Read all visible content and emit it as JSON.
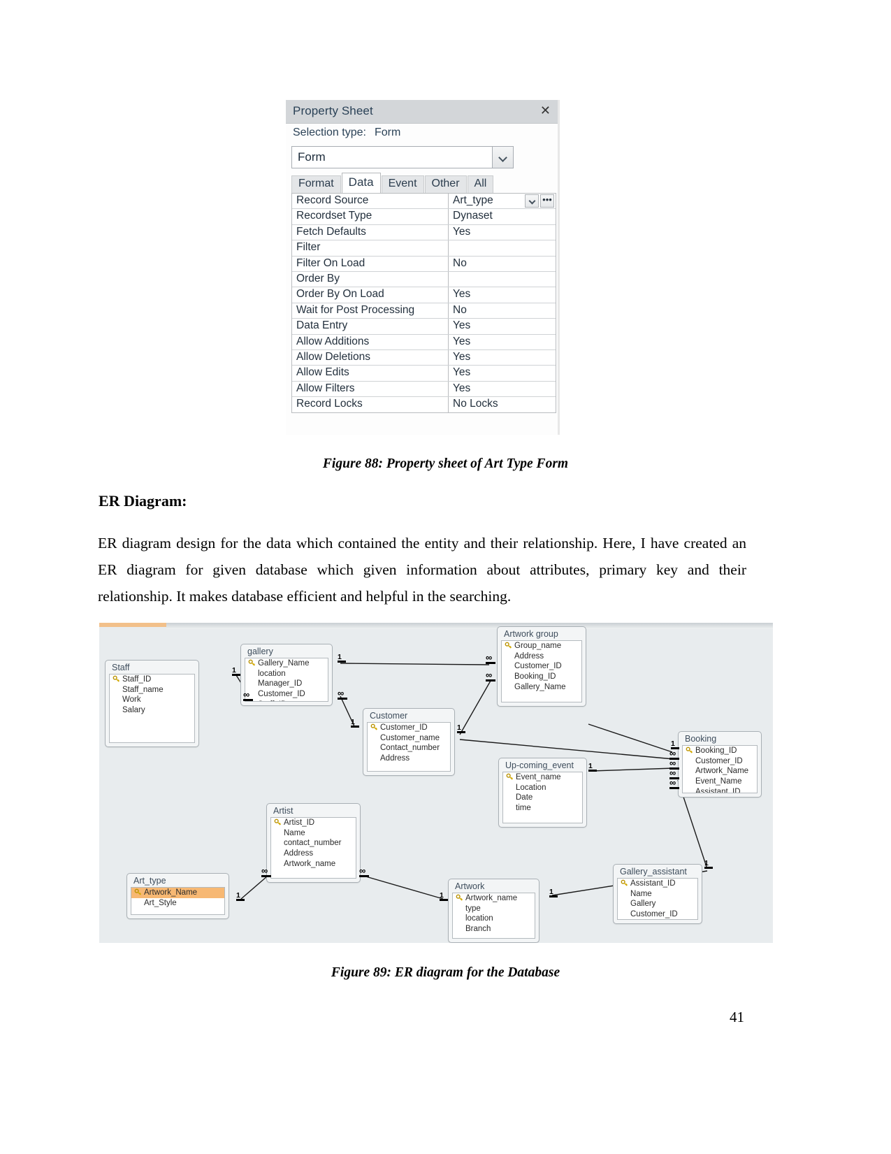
{
  "figure88": {
    "title": "Property Sheet",
    "close_icon": "close-icon",
    "selection_label": "Selection type:",
    "selection_value": "Form",
    "combo_value": "Form",
    "tabs": [
      "Format",
      "Data",
      "Event",
      "Other",
      "All"
    ],
    "active_tab": "Data",
    "properties": [
      {
        "key": "Record Source",
        "value": "Art_type"
      },
      {
        "key": "Recordset Type",
        "value": "Dynaset"
      },
      {
        "key": "Fetch Defaults",
        "value": "Yes"
      },
      {
        "key": "Filter",
        "value": ""
      },
      {
        "key": "Filter On Load",
        "value": "No"
      },
      {
        "key": "Order By",
        "value": ""
      },
      {
        "key": "Order By On Load",
        "value": "Yes"
      },
      {
        "key": "Wait for Post Processing",
        "value": "No"
      },
      {
        "key": "Data Entry",
        "value": "Yes"
      },
      {
        "key": "Allow Additions",
        "value": "Yes"
      },
      {
        "key": "Allow Deletions",
        "value": "Yes"
      },
      {
        "key": "Allow Edits",
        "value": "Yes"
      },
      {
        "key": "Allow Filters",
        "value": "Yes"
      },
      {
        "key": "Record Locks",
        "value": "No Locks"
      }
    ],
    "caption": "Figure 88: Property sheet of Art Type Form"
  },
  "section": {
    "heading": "ER Diagram:",
    "paragraph": "ER diagram design for the data which contained the entity and their relationship. Here, I have created an ER diagram for given database which given information about attributes, primary key and their relationship. It makes database efficient and helpful in the searching."
  },
  "figure89": {
    "caption": "Figure 89: ER diagram for the Database",
    "entities": [
      {
        "name": "Staff",
        "fields": [
          "Staff_ID",
          "Staff_name",
          "Work",
          "Salary"
        ],
        "pk": "Staff_ID"
      },
      {
        "name": "gallery",
        "fields": [
          "Gallery_Name",
          "location",
          "Manager_ID",
          "Customer_ID",
          "Staff_ID"
        ],
        "pk": "Gallery_Name"
      },
      {
        "name": "Artwork group",
        "fields": [
          "Group_name",
          "Address",
          "Customer_ID",
          "Booking_ID",
          "Gallery_Name"
        ],
        "pk": "Group_name"
      },
      {
        "name": "Customer",
        "fields": [
          "Customer_ID",
          "Customer_name",
          "Contact_number",
          "Address"
        ],
        "pk": "Customer_ID"
      },
      {
        "name": "Up-coming_event",
        "fields": [
          "Event_name",
          "Location",
          "Date",
          "time"
        ],
        "pk": "Event_name"
      },
      {
        "name": "Booking",
        "fields": [
          "Booking_ID",
          "Customer_ID",
          "Artwork_Name",
          "Event_Name",
          "Assistant_ID"
        ],
        "pk": "Booking_ID"
      },
      {
        "name": "Artist",
        "fields": [
          "Artist_ID",
          "Name",
          "contact_number",
          "Address",
          "Artwork_name"
        ],
        "pk": "Artist_ID"
      },
      {
        "name": "Art_type",
        "fields": [
          "Artwork_Name",
          "Art_Style"
        ],
        "pk": "Artwork_Name",
        "highlight_pk": true
      },
      {
        "name": "Artwork",
        "fields": [
          "Artwork_name",
          "type",
          "location",
          "Branch"
        ],
        "pk": "Artwork_name"
      },
      {
        "name": "Gallery_assistant",
        "fields": [
          "Assistant_ID",
          "Name",
          "Gallery",
          "Customer_ID"
        ],
        "pk": "Assistant_ID"
      }
    ],
    "cardinalities": {
      "one": "1",
      "many": "∞"
    }
  },
  "page_number": "41"
}
